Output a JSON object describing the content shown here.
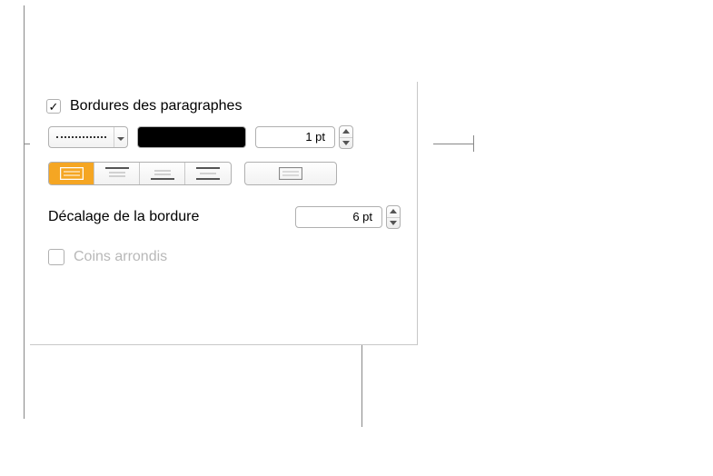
{
  "panel": {
    "title": "Bordures des paragraphes",
    "borders_enabled": true,
    "line_style": "dotted",
    "color": "#000000",
    "weight": "1 pt",
    "offset_label": "Décalage de la bordure",
    "offset_value": "6 pt",
    "rounded_label": "Coins arrondis",
    "rounded_checked": false,
    "border_position_selected": 0
  }
}
